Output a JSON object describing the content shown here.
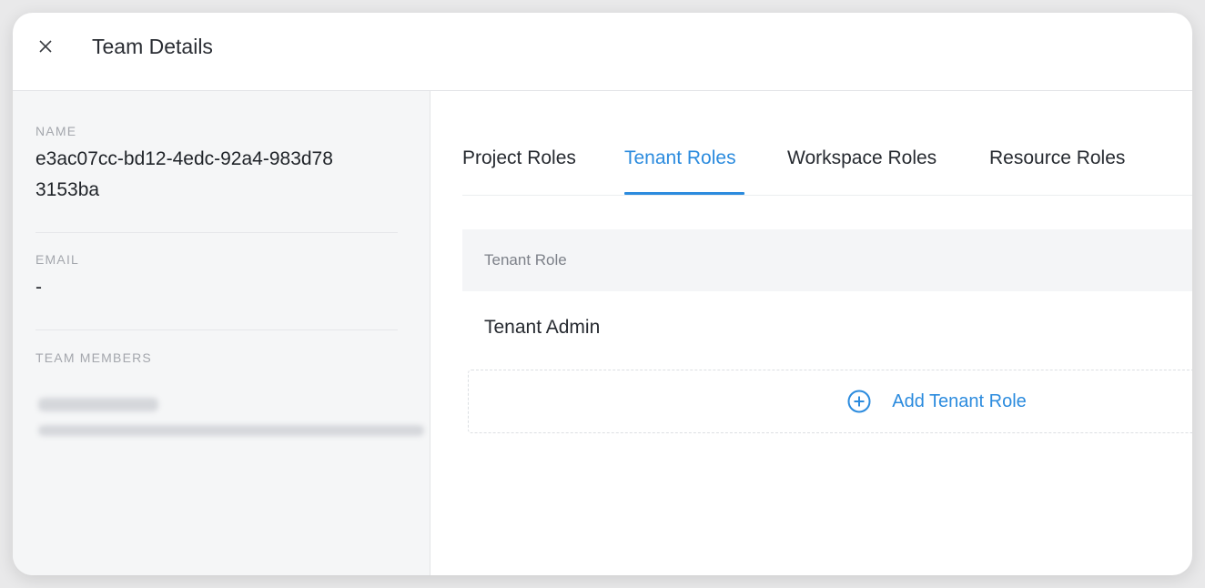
{
  "header": {
    "title": "Team Details",
    "close_icon": "close-icon"
  },
  "sidebar": {
    "name_label": "NAME",
    "name_value": "e3ac07cc-bd12-4edc-92a4-983d783153ba",
    "email_label": "EMAIL",
    "email_value": "-",
    "members_label": "TEAM MEMBERS"
  },
  "tabs": [
    {
      "label": "Project Roles"
    },
    {
      "label": "Tenant Roles"
    },
    {
      "label": "Workspace Roles"
    },
    {
      "label": "Resource Roles"
    }
  ],
  "active_tab": "Tenant Roles",
  "table": {
    "header": "Tenant Role",
    "rows": [
      {
        "role": "Tenant Admin"
      }
    ]
  },
  "add_button": {
    "label": "Add Tenant Role",
    "icon": "plus-circle-icon"
  },
  "colors": {
    "accent": "#2b8bde",
    "sidebar_bg": "#f5f6f7"
  }
}
